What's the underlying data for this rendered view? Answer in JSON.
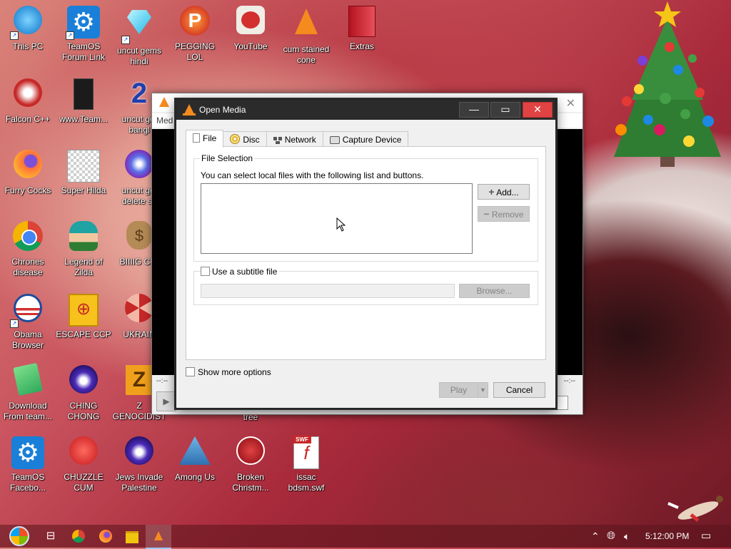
{
  "desktop": {
    "icons": [
      {
        "label": "This PC",
        "icon": "this-pc-icon"
      },
      {
        "label": "TeamOS Forum Link",
        "icon": "gear-icon"
      },
      {
        "label": "uncut gems hindi",
        "icon": "gem-icon"
      },
      {
        "label": "PEGGING LOL",
        "icon": "p-letter-icon"
      },
      {
        "label": "YouTube",
        "icon": "angry-bird-icon"
      },
      {
        "label": "cum stained cone",
        "icon": "vlc-cone-icon"
      },
      {
        "label": "Extras",
        "icon": "red-box-icon"
      },
      {
        "label": "Falcon C++",
        "icon": "falcon-icon"
      },
      {
        "label": "www.Team...",
        "icon": "usb-drive-icon"
      },
      {
        "label": "uncut gei bangl",
        "icon": "number-2-icon"
      },
      {
        "label": "Furry Cocks",
        "icon": "firefox-icon"
      },
      {
        "label": "Super Hilda",
        "icon": "pixel-cat-icon"
      },
      {
        "label": "uncut gei delete sc",
        "icon": "gem-icon"
      },
      {
        "label": "Chrones disease",
        "icon": "chrome-icon"
      },
      {
        "label": "Legend of Zilda",
        "icon": "zelda-icon"
      },
      {
        "label": "BIIIIG CUI",
        "icon": "money-bag-icon"
      },
      {
        "label": "Obama Browser",
        "icon": "obama-logo-icon"
      },
      {
        "label": "ESCAPE CCP",
        "icon": "mahjong-tile-icon"
      },
      {
        "label": "UKRAIN",
        "icon": "radiation-icon"
      },
      {
        "label": "Download From team...",
        "icon": "notepad-icon"
      },
      {
        "label": "CHING CHONG",
        "icon": "purple-orb-icon"
      },
      {
        "label": "Z GENOCIDIST",
        "icon": "z-tile-icon"
      },
      {
        "label": "tree",
        "icon": "tree-icon"
      },
      {
        "label": "TeamOS Facebo...",
        "icon": "gear-icon"
      },
      {
        "label": "CHUZZLE CUM",
        "icon": "chuzzle-icon"
      },
      {
        "label": "Jews Invade Palestine",
        "icon": "purple-orb-icon"
      },
      {
        "label": "Among Us",
        "icon": "among-us-icon"
      },
      {
        "label": "Broken Christm...",
        "icon": "ornament-icon"
      },
      {
        "label": "issac bdsm.swf",
        "icon": "swf-file-icon"
      }
    ]
  },
  "vlc_main": {
    "menu": "Med",
    "time_left": "--:--",
    "time_right": "--:--"
  },
  "dialog": {
    "title": "Open Media",
    "window_buttons": {
      "minimize": "—",
      "maximize": "▭",
      "close": "✕"
    },
    "tabs": [
      {
        "label": "File",
        "icon": "file-icon"
      },
      {
        "label": "Disc",
        "icon": "disc-icon"
      },
      {
        "label": "Network",
        "icon": "network-icon"
      },
      {
        "label": "Capture Device",
        "icon": "capture-device-icon"
      }
    ],
    "file_selection": {
      "group_label": "File Selection",
      "hint": "You can select local files with the following list and buttons.",
      "add_button": "Add...",
      "remove_button": "Remove"
    },
    "subtitle": {
      "checkbox_label": "Use a subtitle file",
      "browse_button": "Browse..."
    },
    "show_more_options": "Show more options",
    "play_button": "Play",
    "cancel_button": "Cancel"
  },
  "taskbar": {
    "time": "5:12:00 PM",
    "icons": [
      "start-orb-icon",
      "task-view-icon",
      "chrome-icon",
      "firefox-icon",
      "file-explorer-icon",
      "vlc-cone-icon"
    ],
    "tray_icons": [
      "chevron-up-icon",
      "network-globe-icon",
      "speaker-icon",
      "notifications-icon"
    ]
  },
  "colors": {
    "dialog_title_bar": "#2b2b2b",
    "close_button": "#e04343",
    "vlc_orange": "#f58a1f"
  }
}
